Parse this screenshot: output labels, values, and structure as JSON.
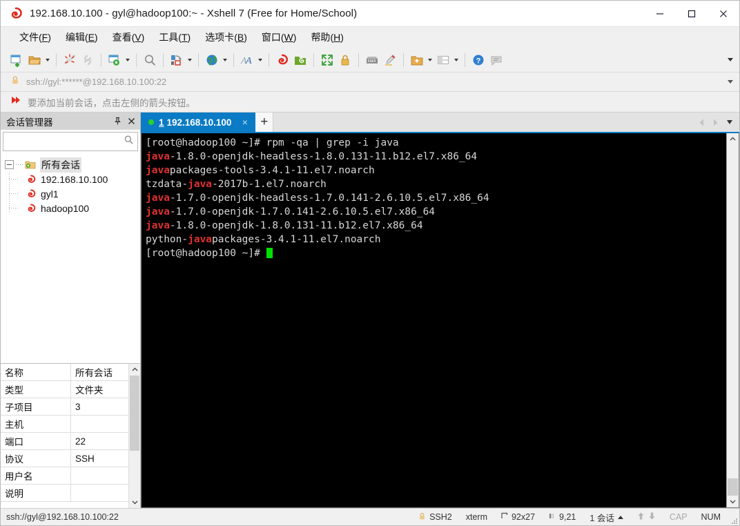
{
  "window": {
    "title": "192.168.10.100 - gyl@hadoop100:~ - Xshell 7 (Free for Home/School)",
    "app_icon": "xshell-logo-icon",
    "minimize_label": "Minimize",
    "maximize_label": "Maximize",
    "close_label": "Close"
  },
  "menu": {
    "items": [
      {
        "label": "文件",
        "accel": "F"
      },
      {
        "label": "编辑",
        "accel": "E"
      },
      {
        "label": "查看",
        "accel": "V"
      },
      {
        "label": "工具",
        "accel": "T"
      },
      {
        "label": "选项卡",
        "accel": "B"
      },
      {
        "label": "窗口",
        "accel": "W"
      },
      {
        "label": "帮助",
        "accel": "H"
      }
    ]
  },
  "toolbar": {
    "buttons": [
      {
        "name": "new-session-icon",
        "caret": false
      },
      {
        "name": "open-session-icon",
        "caret": true
      },
      {
        "name": "disconnect-icon",
        "caret": false
      },
      {
        "name": "reconnect-icon",
        "caret": false
      },
      {
        "name": "session-properties-icon",
        "caret": true
      },
      {
        "name": "find-icon",
        "caret": false
      },
      {
        "name": "transfer-file-icon",
        "caret": true
      },
      {
        "name": "globe-encoding-icon",
        "caret": true
      },
      {
        "name": "font-size-icon",
        "caret": true
      },
      {
        "name": "xshell-icon",
        "caret": false
      },
      {
        "name": "xftp-icon",
        "caret": false
      },
      {
        "name": "fullscreen-icon",
        "caret": false
      },
      {
        "name": "lock-icon",
        "caret": false
      },
      {
        "name": "keyboard-icon",
        "caret": false
      },
      {
        "name": "highlight-icon",
        "caret": false
      },
      {
        "name": "add-folder-icon",
        "caret": true
      },
      {
        "name": "layout-icon",
        "caret": true
      },
      {
        "name": "help-icon",
        "caret": false
      },
      {
        "name": "chat-icon",
        "caret": false
      }
    ],
    "overflow_name": "toolbar-overflow-icon"
  },
  "address_bar": {
    "lock_icon": "lock-icon",
    "value": "ssh://gyl:******@192.168.10.100:22",
    "dropdown_icon": "chevron-down-icon"
  },
  "notice": {
    "icon": "red-arrow-icon",
    "text": "要添加当前会话，点击左侧的箭头按钮。"
  },
  "sidebar": {
    "title": "会话管理器",
    "pin_label": "固定",
    "close_label": "关闭",
    "search": {
      "value": "",
      "placeholder": "",
      "icon": "search-icon"
    },
    "tree": {
      "root": {
        "label": "所有会话",
        "icon": "folder-sessions-icon",
        "expanded": true
      },
      "children": [
        {
          "label": "192.168.10.100",
          "icon": "session-icon"
        },
        {
          "label": "gyl1",
          "icon": "session-icon"
        },
        {
          "label": "hadoop100",
          "icon": "session-icon"
        }
      ]
    },
    "properties": {
      "rows": [
        {
          "key": "名称",
          "value": "所有会话"
        },
        {
          "key": "类型",
          "value": "文件夹"
        },
        {
          "key": "子项目",
          "value": "3"
        },
        {
          "key": "主机",
          "value": ""
        },
        {
          "key": "端口",
          "value": "22"
        },
        {
          "key": "协议",
          "value": "SSH"
        },
        {
          "key": "用户名",
          "value": ""
        },
        {
          "key": "说明",
          "value": ""
        }
      ]
    }
  },
  "tabs": {
    "items": [
      {
        "number": "1",
        "title": "192.168.10.100",
        "status": "connected",
        "active": true
      }
    ],
    "new_tab_label": "+",
    "close_label": "×",
    "nav_prev": "chevron-left-icon",
    "nav_next": "chevron-right-icon",
    "nav_menu": "chevron-down-icon"
  },
  "terminal": {
    "lines": [
      {
        "segments": [
          {
            "t": "[root@hadoop100 ~]# rpm -qa | grep -i java",
            "c": "w"
          }
        ]
      },
      {
        "segments": [
          {
            "t": "java",
            "c": "r"
          },
          {
            "t": "-1.8.0-openjdk-headless-1.8.0.131-11.b12.el7.x86_64",
            "c": "w"
          }
        ]
      },
      {
        "segments": [
          {
            "t": "java",
            "c": "r"
          },
          {
            "t": "packages-tools-3.4.1-11.el7.noarch",
            "c": "w"
          }
        ]
      },
      {
        "segments": [
          {
            "t": "tzdata-",
            "c": "w"
          },
          {
            "t": "java",
            "c": "r"
          },
          {
            "t": "-2017b-1.el7.noarch",
            "c": "w"
          }
        ]
      },
      {
        "segments": [
          {
            "t": "java",
            "c": "r"
          },
          {
            "t": "-1.7.0-openjdk-headless-1.7.0.141-2.6.10.5.el7.x86_64",
            "c": "w"
          }
        ]
      },
      {
        "segments": [
          {
            "t": "java",
            "c": "r"
          },
          {
            "t": "-1.7.0-openjdk-1.7.0.141-2.6.10.5.el7.x86_64",
            "c": "w"
          }
        ]
      },
      {
        "segments": [
          {
            "t": "java",
            "c": "r"
          },
          {
            "t": "-1.8.0-openjdk-1.8.0.131-11.b12.el7.x86_64",
            "c": "w"
          }
        ]
      },
      {
        "segments": [
          {
            "t": "python-",
            "c": "w"
          },
          {
            "t": "java",
            "c": "r"
          },
          {
            "t": "packages-3.4.1-11.el7.noarch",
            "c": "w"
          }
        ]
      },
      {
        "segments": [
          {
            "t": "[root@hadoop100 ~]# ",
            "c": "w"
          }
        ],
        "cursor": true
      }
    ]
  },
  "statusbar": {
    "connection": "ssh://gyl@192.168.10.100:22",
    "security_icon": "lock-icon",
    "protocol": "SSH2",
    "term_type": "xterm",
    "size_icon": "terminal-size-icon",
    "size": "92x27",
    "cursor_icon": "cursor-position-icon",
    "cursor_pos": "9,21",
    "sessions": "1 会话",
    "sessions_caret": "caret-up-icon",
    "xfer_up_icon": "transfer-up-icon",
    "xfer_down_icon": "transfer-down-icon",
    "caps": "CAP",
    "num": "NUM",
    "grip": "resize-grip-icon"
  }
}
